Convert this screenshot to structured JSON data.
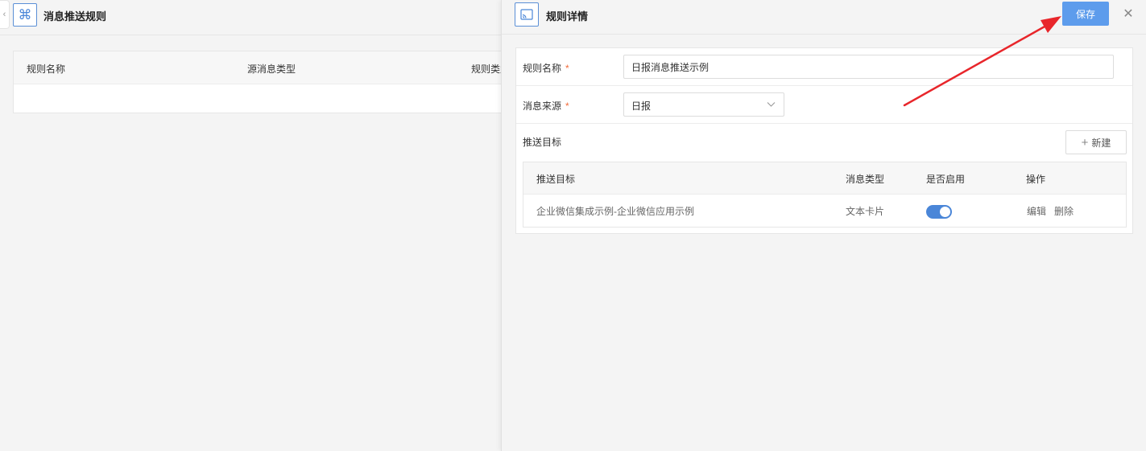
{
  "left_page": {
    "title": "消息推送规则",
    "collapse_glyph": "‹",
    "table_headers": [
      "规则名称",
      "源消息类型",
      "规则类型"
    ]
  },
  "drawer": {
    "title": "规则详情",
    "save_label": "保存",
    "close_glyph": "✕",
    "form": {
      "rule_name": {
        "label": "规则名称",
        "required_mark": "*",
        "value": "日报消息推送示例"
      },
      "source": {
        "label": "消息来源",
        "required_mark": "*",
        "value": "日报"
      },
      "targets_label": "推送目标",
      "new_button_label": "新建",
      "new_button_glyph": "+"
    },
    "target_table": {
      "headers": {
        "target": "推送目标",
        "message_type": "消息类型",
        "enabled": "是否启用",
        "actions": "操作"
      },
      "rows": [
        {
          "target": "企业微信集成示例-企业微信应用示例",
          "message_type": "文本卡片",
          "enabled": true,
          "edit_label": "编辑",
          "delete_label": "删除"
        }
      ]
    }
  },
  "icons": {
    "app": "command-icon",
    "drawer": "cast-icon",
    "annotation": "red-arrow-icon"
  },
  "colors": {
    "primary": "#5d9cec",
    "link": "#4a86d8",
    "required": "#f26b3a",
    "annotation_arrow": "#e8262b",
    "background": "#f4f4f4"
  }
}
